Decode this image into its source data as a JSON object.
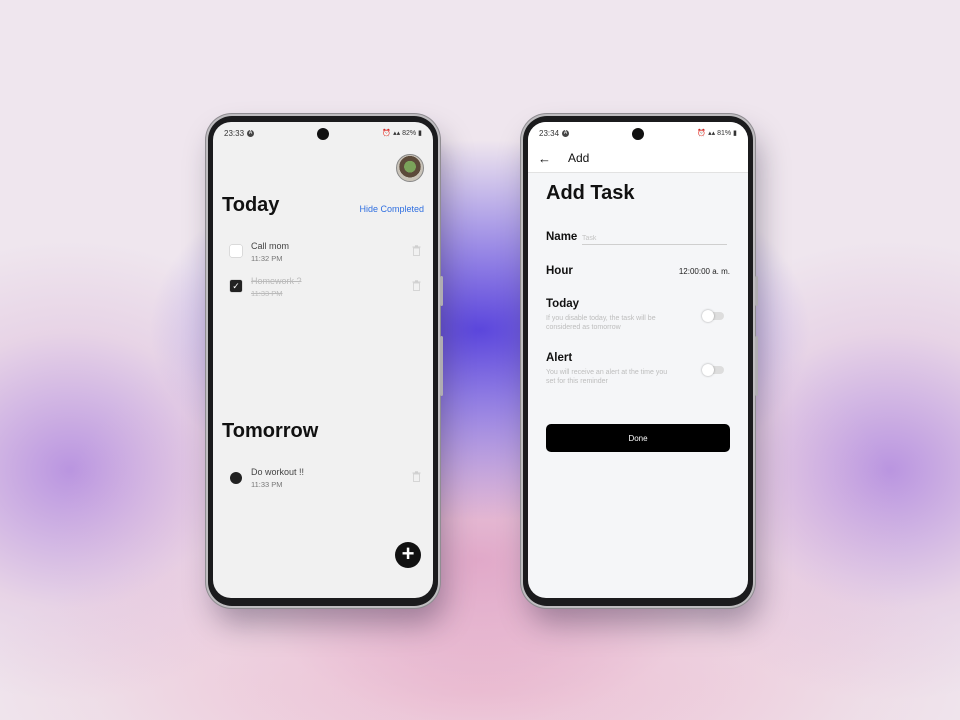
{
  "list_screen": {
    "status_time": "23:33",
    "battery": "82%",
    "today_title": "Today",
    "hide_completed": "Hide Completed",
    "today_tasks": [
      {
        "name": "Call mom",
        "time": "11:32 PM",
        "completed": false
      },
      {
        "name": "Homework ?",
        "time": "11:33 PM",
        "completed": true
      }
    ],
    "tomorrow_title": "Tomorrow",
    "tomorrow_tasks": [
      {
        "name": "Do workout !!",
        "time": "11:33 PM"
      }
    ],
    "fab_label": "+"
  },
  "add_screen": {
    "status_time": "23:34",
    "battery": "81%",
    "bar_title": "Add",
    "title": "Add Task",
    "name_label": "Name",
    "name_placeholder": "Task",
    "name_value": "",
    "hour_label": "Hour",
    "hour_value": "12:00:00 a. m.",
    "today_label": "Today",
    "today_hint": "If you disable today, the task will be considered as tomorrow",
    "today_toggle_on": false,
    "alert_label": "Alert",
    "alert_hint": "You will receive an alert at the time you set for this reminder",
    "alert_toggle_on": false,
    "done_label": "Done"
  },
  "icons": {
    "back": "arrow-left-icon",
    "trash": "trash-icon",
    "add": "plus-icon",
    "check": "checkmark-icon"
  },
  "colors": {
    "link": "#2f6fe0",
    "primary": "#000000",
    "background_accent": "#5b46dc"
  }
}
